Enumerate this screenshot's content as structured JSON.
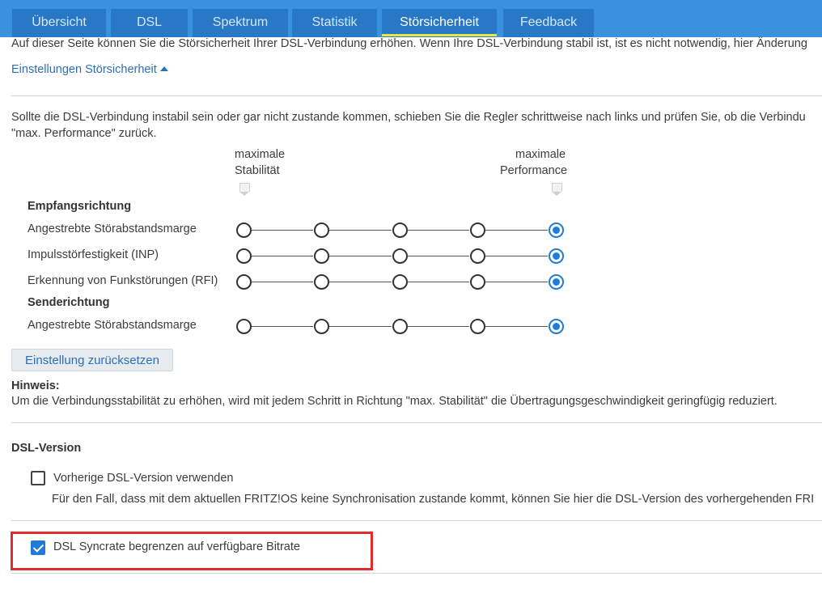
{
  "tabs": [
    "Übersicht",
    "DSL",
    "Spektrum",
    "Statistik",
    "Störsicherheit",
    "Feedback"
  ],
  "active_tab": "Störsicherheit",
  "intro": "Auf dieser Seite können Sie die Störsicherheit Ihrer DSL-Verbindung erhöhen. Wenn Ihre DSL-Verbindung stabil ist, ist es nicht notwendig, hier Änderung",
  "settings_link": "Einstellungen Störsicherheit",
  "instructions_1": "Sollte die DSL-Verbindung instabil sein oder gar nicht zustande kommen, schieben Sie die Regler schrittweise nach links und prüfen Sie, ob die Verbindu",
  "instructions_2": "\"max. Performance\" zurück.",
  "scale": {
    "left_1": "maximale",
    "left_2": "Stabilität",
    "right_1": "maximale",
    "right_2": "Performance",
    "positions": 5
  },
  "sections": {
    "receive": "Empfangsrichtung",
    "send": "Senderichtung"
  },
  "sliders": [
    {
      "label": "Angestrebte Störabstandsmarge",
      "selected": 5
    },
    {
      "label": "Impulsstörfestigkeit (INP)",
      "selected": 5
    },
    {
      "label": "Erkennung von Funkstörungen (RFI)",
      "selected": 5
    },
    {
      "label": "Angestrebte Störabstandsmarge",
      "selected": 5
    }
  ],
  "reset_button": "Einstellung zurücksetzen",
  "hint_title": "Hinweis:",
  "hint_text": "Um die Verbindungsstabilität zu erhöhen, wird mit jedem Schritt in Richtung \"max. Stabilität\" die Übertragungsgeschwindigkeit geringfügig reduziert.",
  "dsl_version": {
    "heading": "DSL-Version",
    "prev_label": "Vorherige DSL-Version verwenden",
    "prev_checked": false,
    "prev_desc": "Für den Fall, dass mit dem aktuellen FRITZ!OS keine Synchronisation zustande kommt, können Sie hier die DSL-Version des vorhergehenden FRI",
    "syncrate_label": "DSL Syncrate begrenzen auf verfügbare Bitrate",
    "syncrate_checked": true
  },
  "colors": {
    "topbar": "#3a92dc",
    "tab": "#2878c5",
    "tab_underline": "#e3ea3b",
    "accent": "#1f7ad8",
    "link": "#2e6eb5",
    "highlight_box": "#e32b2b"
  }
}
